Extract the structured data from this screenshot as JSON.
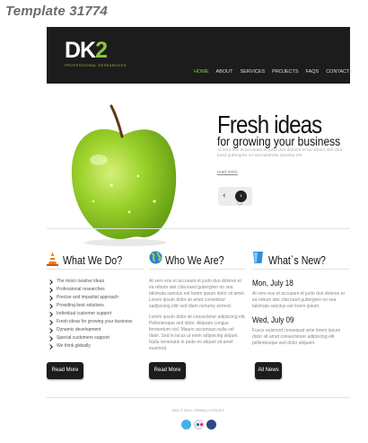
{
  "template_title": "Template 31774",
  "header": {
    "logo_dk": "DK",
    "logo_2": "2",
    "logo_sub": "PROFESSIONAL RESEARCHES",
    "nav": [
      "HOME",
      "ABOUT",
      "SERVICES",
      "PROJECTS",
      "FAQS",
      "CONTACTS"
    ],
    "active_nav": "HOME"
  },
  "slider": {
    "heading": "Fresh ideas",
    "subheading": "for growing your business",
    "text": "At vero eos et accusam et justo duo dolores et ea rebum stet clita kasd gubergren no sea takimata sanctus est",
    "link": "read more",
    "prev": "‹",
    "next": "›"
  },
  "columns": {
    "what": {
      "title": "What We Do?",
      "items": [
        "The most creative ideas",
        "Professional researches",
        "Precise and impartial approach",
        "Providing best solutions",
        "Individual customer support",
        "Fresh ideas for growing your business",
        "Dynamic development",
        "Special customers support",
        "We think globally"
      ],
      "button": "Read More"
    },
    "who": {
      "title": "Who We Are?",
      "p1": "At vero eos et accusam et justo duo dolores et ea rebum stet clita kasd gubergren no sea takimata sanctus est lorem ipsum dolor sit amet. Lorem ipsum dolor sit amet consetetur sadipscing elitr sed diam nonumy eirmod.",
      "p2": "Lorem ipsum dolor sit consectetur adipiscing elit. Pellentesque sed dolor. Aliquam congue fermentum nisl. Mauris accumsan nulla vel diam. Sed in lacus ut enim adipiscing aliquet. Nulla venenatis in pede mi aliquet sit amet euismod.",
      "button": "Read More"
    },
    "news": {
      "title": "What`s New?",
      "date1": "Mon, July 18",
      "text1": "At vero eos et accusam et justo duo dolores et ea rebum stet clita kasd gubergren no sea takimata sanctus est lorem ipsum.",
      "date2": "Wed, July 09",
      "text2": "Fusce euismod consequat ante lorem ipsum dolor sit amet consectetuer adipiscing elit pellentesque sed dolor aliquam.",
      "button": "All News"
    }
  },
  "footer": {
    "text": "DK2 © 2011 • PRIVACY POLICY"
  },
  "colors": {
    "accent": "#8dc63f",
    "dark": "#1c1c1c"
  },
  "icons": [
    "cone-icon",
    "globe-icon",
    "cup-icon",
    "twitter-icon",
    "flickr-icon",
    "delicious-icon",
    "cursor-icon"
  ]
}
